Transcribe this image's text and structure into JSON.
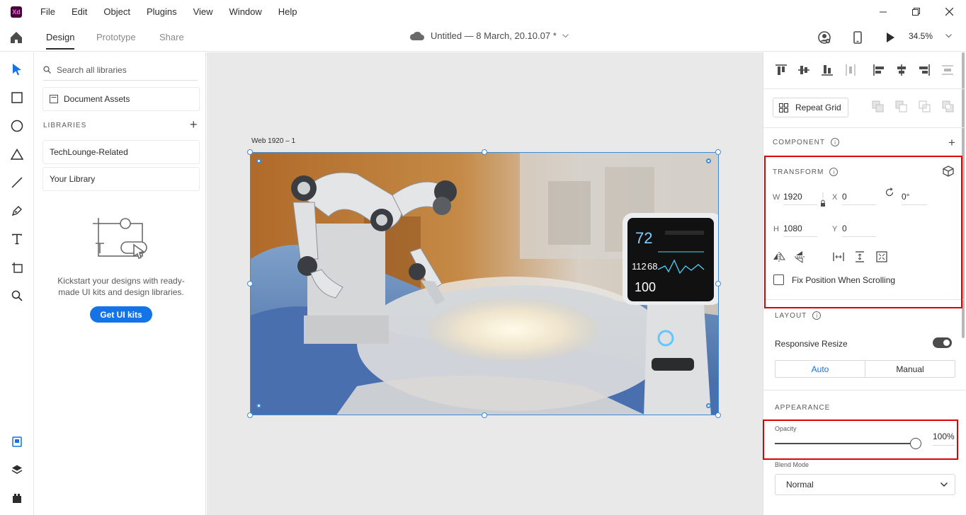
{
  "app": {
    "logo_text": "Xd",
    "menu": [
      "File",
      "Edit",
      "Object",
      "Plugins",
      "View",
      "Window",
      "Help"
    ]
  },
  "tabs": {
    "items": [
      "Design",
      "Prototype",
      "Share"
    ],
    "active": "Design",
    "document_title": "Untitled — 8 March, 20.10.07 *",
    "zoom": "34.5%"
  },
  "libraries": {
    "search_placeholder": "Search all libraries",
    "document_assets": "Document Assets",
    "section_title": "LIBRARIES",
    "items": [
      "TechLounge-Related",
      "Your Library"
    ],
    "blurb": "Kickstart your designs with ready-made UI kits and design libraries.",
    "cta": "Get UI kits"
  },
  "canvas": {
    "artboard_name": "Web 1920 – 1"
  },
  "inspector": {
    "repeat_grid": "Repeat Grid",
    "component_title": "COMPONENT",
    "transform_title": "TRANSFORM",
    "w_label": "W",
    "w_value": "1920",
    "x_label": "X",
    "x_value": "0",
    "h_label": "H",
    "h_value": "1080",
    "y_label": "Y",
    "y_value": "0",
    "rotation": "0°",
    "fix_position": "Fix Position When Scrolling",
    "layout_title": "LAYOUT",
    "responsive_resize": "Responsive Resize",
    "resize_options": [
      "Auto",
      "Manual"
    ],
    "appearance_title": "APPEARANCE",
    "opacity_label": "Opacity",
    "opacity_value": "100%",
    "opacity_fraction": 1.0,
    "blend_label": "Blend Mode",
    "blend_value": "Normal"
  },
  "monitor": {
    "readout_top": "72",
    "readout_mid_a": "112",
    "readout_mid_b": "68",
    "readout_bottom": "100"
  },
  "colors": {
    "accent": "#1473e6",
    "selection": "#3d8bd6",
    "highlight": "#e00000"
  }
}
